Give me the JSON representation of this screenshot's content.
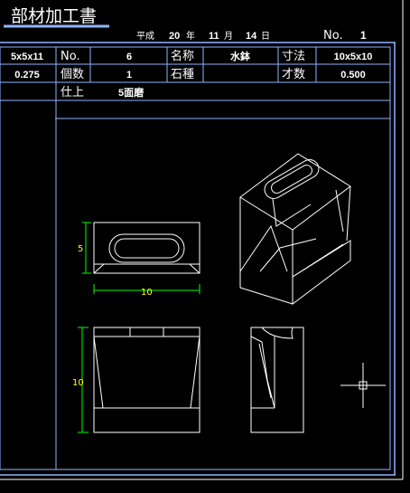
{
  "title": "部材加工書",
  "date": {
    "era": "平成",
    "year": "20",
    "year_unit": "年",
    "month": "11",
    "month_unit": "月",
    "day": "14",
    "day_unit": "日"
  },
  "sheet_no": {
    "label": "No.",
    "value": "1"
  },
  "left_col": {
    "row1": "5x5x11",
    "row2": "0.275"
  },
  "table": {
    "no_label": "No.",
    "no_value": "6",
    "name_label": "名称",
    "name_value": "水鉢",
    "size_label": "寸法",
    "size_value": "10x5x10",
    "qty_label": "個数",
    "qty_value": "1",
    "stone_label": "石種",
    "stone_value": "",
    "volume_label": "才数",
    "volume_value": "0.500",
    "finish_label": "仕上",
    "finish_value": "5面磨"
  },
  "dimensions": {
    "top_width": "10",
    "top_height": "5",
    "front_height": "10"
  },
  "colors": {
    "frame": "#8fb4ff",
    "line": "#ffffff",
    "dim": "#00ff00",
    "dim_text": "#ffff00",
    "title": "#ffffff"
  }
}
